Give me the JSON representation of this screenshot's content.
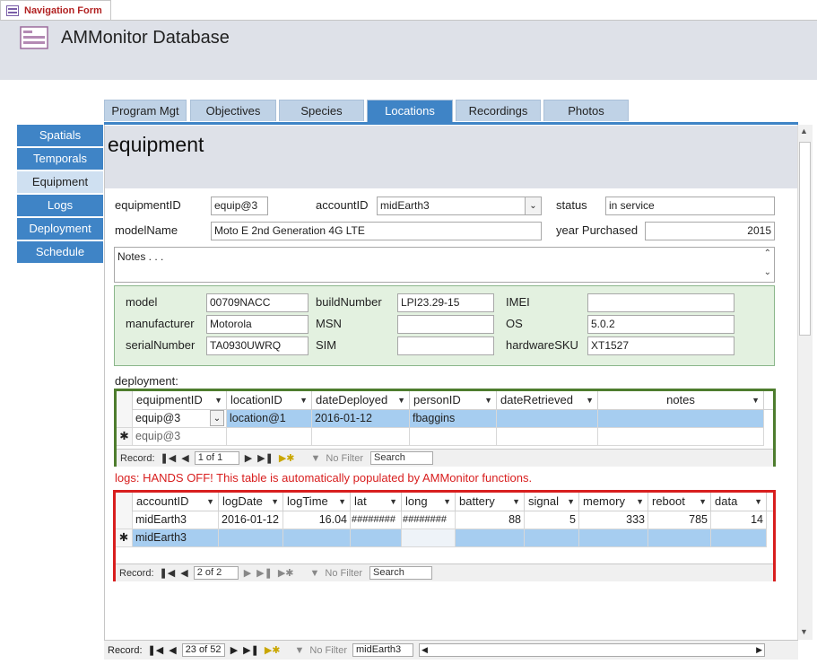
{
  "doc_tab": {
    "label": "Navigation Form"
  },
  "header": {
    "title": "AMMonitor Database"
  },
  "side_nav": [
    {
      "label": "Spatials",
      "active": false
    },
    {
      "label": "Temporals",
      "active": false
    },
    {
      "label": "Equipment",
      "active": true
    },
    {
      "label": "Logs",
      "active": false
    },
    {
      "label": "Deployment",
      "active": false
    },
    {
      "label": "Schedule",
      "active": false
    }
  ],
  "tabs": [
    {
      "label": "Program Mgt",
      "active": false
    },
    {
      "label": "Objectives",
      "active": false
    },
    {
      "label": "Species",
      "active": false
    },
    {
      "label": "Locations",
      "active": true
    },
    {
      "label": "Recordings",
      "active": false
    },
    {
      "label": "Photos",
      "active": false
    }
  ],
  "form": {
    "title": "equipment",
    "equipmentID_label": "equipmentID",
    "equipmentID": "equip@3",
    "accountID_label": "accountID",
    "accountID": "midEarth3",
    "status_label": "status",
    "status": "in service",
    "modelName_label": "modelName",
    "modelName": "Moto E 2nd Generation 4G LTE",
    "year_label": "year Purchased",
    "year": "2015",
    "notes": "Notes . . .",
    "model_label": "model",
    "model": "00709NACC",
    "buildNumber_label": "buildNumber",
    "buildNumber": "LPI23.29-15",
    "imei_label": "IMEI",
    "imei": "",
    "manufacturer_label": "manufacturer",
    "manufacturer": "Motorola",
    "msn_label": "MSN",
    "msn": "",
    "os_label": "OS",
    "os": "5.0.2",
    "serialNumber_label": "serialNumber",
    "serialNumber": "TA0930UWRQ",
    "sim_label": "SIM",
    "sim": "",
    "hardwareSKU_label": "hardwareSKU",
    "hardwareSKU": "XT1527"
  },
  "deployment": {
    "label": "deployment:",
    "columns": [
      "equipmentID",
      "locationID",
      "dateDeployed",
      "personID",
      "dateRetrieved",
      "notes"
    ],
    "rows": [
      [
        "equip@3",
        "location@1",
        "2016-01-12",
        "fbaggins",
        "",
        ""
      ]
    ],
    "new_row": "equip@3",
    "nav": {
      "record_label": "Record:",
      "position": "1 of 1",
      "filter": "No Filter",
      "search": "Search"
    }
  },
  "logs": {
    "warning": "logs: HANDS OFF!  This table is automatically populated by AMMonitor functions.",
    "columns": [
      "accountID",
      "logDate",
      "logTime",
      "lat",
      "long",
      "battery",
      "signal",
      "memory",
      "reboot",
      "data"
    ],
    "rows": [
      [
        "midEarth3",
        "2016-01-12",
        "16.04",
        "########",
        "########",
        "88",
        "5",
        "333",
        "785",
        "14"
      ]
    ],
    "new_row": "midEarth3",
    "nav": {
      "record_label": "Record:",
      "position": "2 of 2",
      "filter": "No Filter",
      "search": "Search"
    }
  },
  "main_nav": {
    "record_label": "Record:",
    "position": "23 of 52",
    "filter": "No Filter",
    "search": "midEarth3"
  },
  "colors": {
    "accent": "#3f84c6",
    "deployment_border": "#4e7d2e",
    "logs_border": "#d81e1e",
    "warning": "#d81e1e"
  }
}
